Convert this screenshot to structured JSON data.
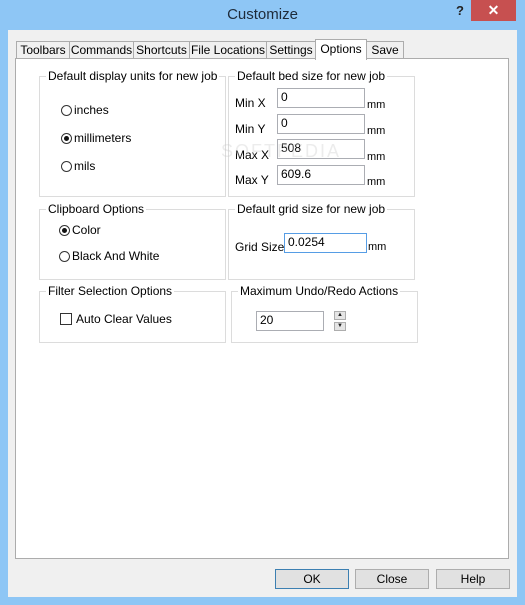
{
  "window": {
    "title": "Customize",
    "help_label": "?",
    "close_label": "✕"
  },
  "tabs": [
    {
      "label": "Toolbars",
      "active": false
    },
    {
      "label": "Commands",
      "active": false
    },
    {
      "label": "Shortcuts",
      "active": false
    },
    {
      "label": "File Locations",
      "active": false
    },
    {
      "label": "Settings",
      "active": false
    },
    {
      "label": "Options",
      "active": true
    },
    {
      "label": "Save",
      "active": false
    }
  ],
  "display_units": {
    "legend": "Default display units for new job",
    "options": [
      {
        "label": "inches",
        "checked": false
      },
      {
        "label": "millimeters",
        "checked": true
      },
      {
        "label": "mils",
        "checked": false
      }
    ]
  },
  "bed_size": {
    "legend": "Default bed size for new job",
    "fields": [
      {
        "label": "Min X",
        "value": "0",
        "unit": "mm"
      },
      {
        "label": "Min Y",
        "value": "0",
        "unit": "mm"
      },
      {
        "label": "Max X",
        "value": "508",
        "unit": "mm"
      },
      {
        "label": "Max Y",
        "value": "609.6",
        "unit": "mm"
      }
    ]
  },
  "clipboard": {
    "legend": "Clipboard Options",
    "options": [
      {
        "label": "Color",
        "checked": true
      },
      {
        "label": "Black And White",
        "checked": false
      }
    ]
  },
  "grid_size": {
    "legend": "Default grid size for new job",
    "label": "Grid Size",
    "value": "0.0254",
    "unit": "mm"
  },
  "filter_selection": {
    "legend": "Filter Selection Options",
    "checkbox_label": "Auto Clear Values",
    "checked": false
  },
  "undo_redo": {
    "legend": "Maximum Undo/Redo Actions",
    "value": "20",
    "up": "▲",
    "down": "▼"
  },
  "buttons": {
    "ok": "OK",
    "close": "Close",
    "help": "Help"
  },
  "watermark": "SOFTPEDIA"
}
